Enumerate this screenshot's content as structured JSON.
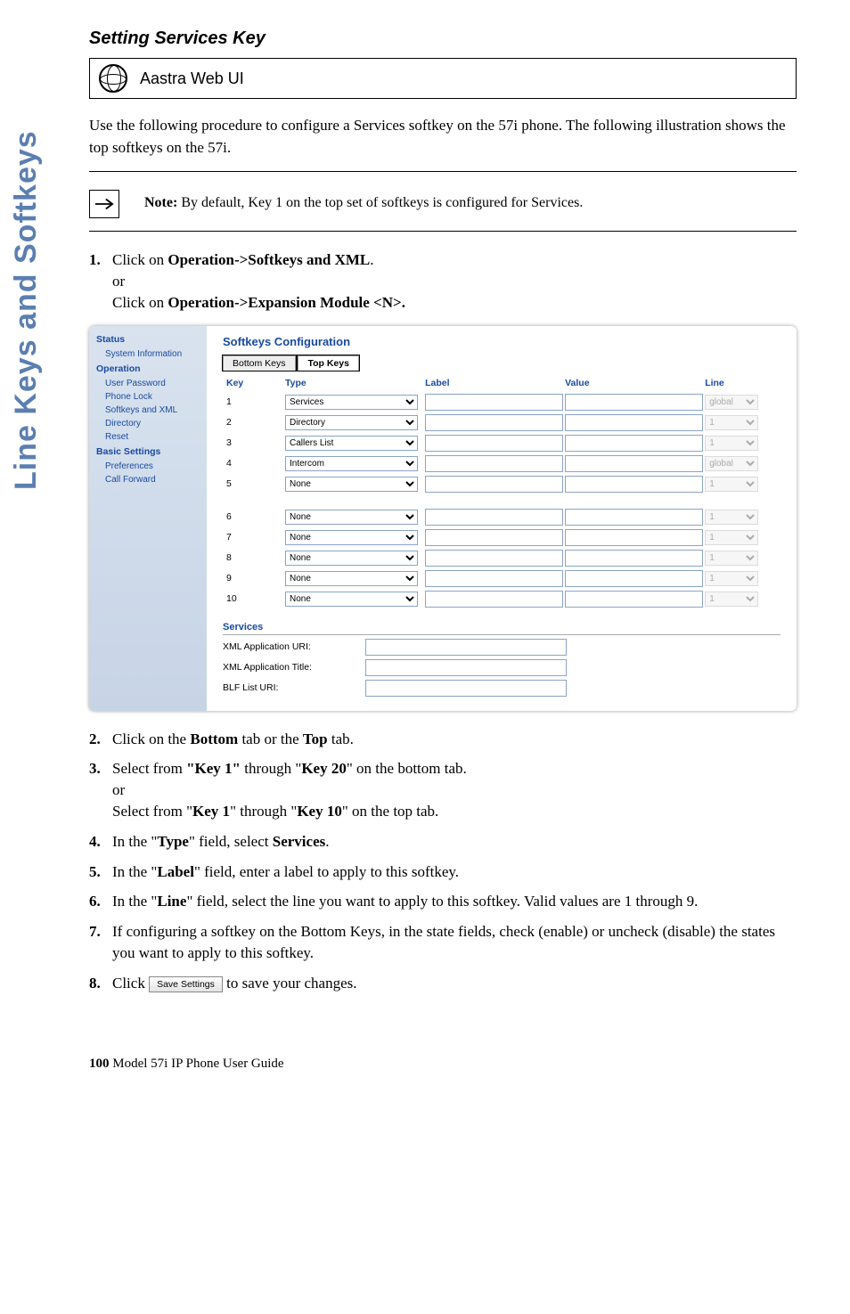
{
  "sideTab": "Line Keys and Softkeys",
  "sectionTitle": "Setting Services Key",
  "webUiLabel": "Aastra Web UI",
  "introText": "Use the following procedure to configure a Services softkey on the 57i phone. The following illustration shows the top softkeys on the 57i.",
  "note": {
    "label": "Note:",
    "text": " By default, Key 1 on the top set of softkeys is configured for Services."
  },
  "steps": {
    "s1a": "Click on ",
    "s1b": "Operation->Softkeys and XML",
    "s1or": "or",
    "s1c": "Click on ",
    "s1d": "Operation->Expansion Module <N>.",
    "s2a": "Click on the ",
    "s2b": "Bottom",
    "s2c": " tab or the ",
    "s2d": "Top",
    "s2e": " tab.",
    "s3a": "Select from ",
    "s3b": "\"Key 1\"",
    "s3c": " through \"",
    "s3d": "Key 20",
    "s3e": "\" on the bottom tab.",
    "s3or": "or",
    "s3f": "Select from \"",
    "s3g": "Key 1",
    "s3h": "\" through \"",
    "s3i": "Key 10",
    "s3j": "\" on the top tab.",
    "s4a": "In the \"",
    "s4b": "Type",
    "s4c": "\" field, select ",
    "s4d": "Services",
    "s4e": ".",
    "s5a": "In the \"",
    "s5b": "Label",
    "s5c": "\" field, enter a label to apply to this softkey.",
    "s6a": "In the \"",
    "s6b": "Line",
    "s6c": "\" field, select the line you want to apply to this softkey. Valid values are 1 through 9.",
    "s7": "If configuring a softkey on the Bottom Keys, in the state fields, check (enable) or uncheck (disable) the states you want to apply to this softkey.",
    "s8a": "Click ",
    "s8btn": "Save Settings",
    "s8b": " to save your changes."
  },
  "screenshot": {
    "nav": {
      "status": "Status",
      "sysinfo": "System Information",
      "operation": "Operation",
      "userpwd": "User Password",
      "phonelock": "Phone Lock",
      "softxml": "Softkeys and XML",
      "directory": "Directory",
      "reset": "Reset",
      "basic": "Basic Settings",
      "prefs": "Preferences",
      "callfwd": "Call Forward"
    },
    "title": "Softkeys Configuration",
    "tabBottom": "Bottom Keys",
    "tabTop": "Top Keys",
    "headers": {
      "key": "Key",
      "type": "Type",
      "label": "Label",
      "value": "Value",
      "line": "Line"
    },
    "rows": [
      {
        "key": "1",
        "type": "Services",
        "line": "global"
      },
      {
        "key": "2",
        "type": "Directory",
        "line": "1"
      },
      {
        "key": "3",
        "type": "Callers List",
        "line": "1"
      },
      {
        "key": "4",
        "type": "Intercom",
        "line": "global"
      },
      {
        "key": "5",
        "type": "None",
        "line": "1"
      },
      {
        "key": "6",
        "type": "None",
        "line": "1"
      },
      {
        "key": "7",
        "type": "None",
        "line": "1"
      },
      {
        "key": "8",
        "type": "None",
        "line": "1"
      },
      {
        "key": "9",
        "type": "None",
        "line": "1"
      },
      {
        "key": "10",
        "type": "None",
        "line": "1"
      }
    ],
    "services": {
      "header": "Services",
      "xmlUri": "XML Application URI:",
      "xmlTitle": "XML Application Title:",
      "blf": "BLF List URI:"
    }
  },
  "footer": {
    "page": "100",
    "text": "  Model 57i IP Phone User Guide"
  }
}
